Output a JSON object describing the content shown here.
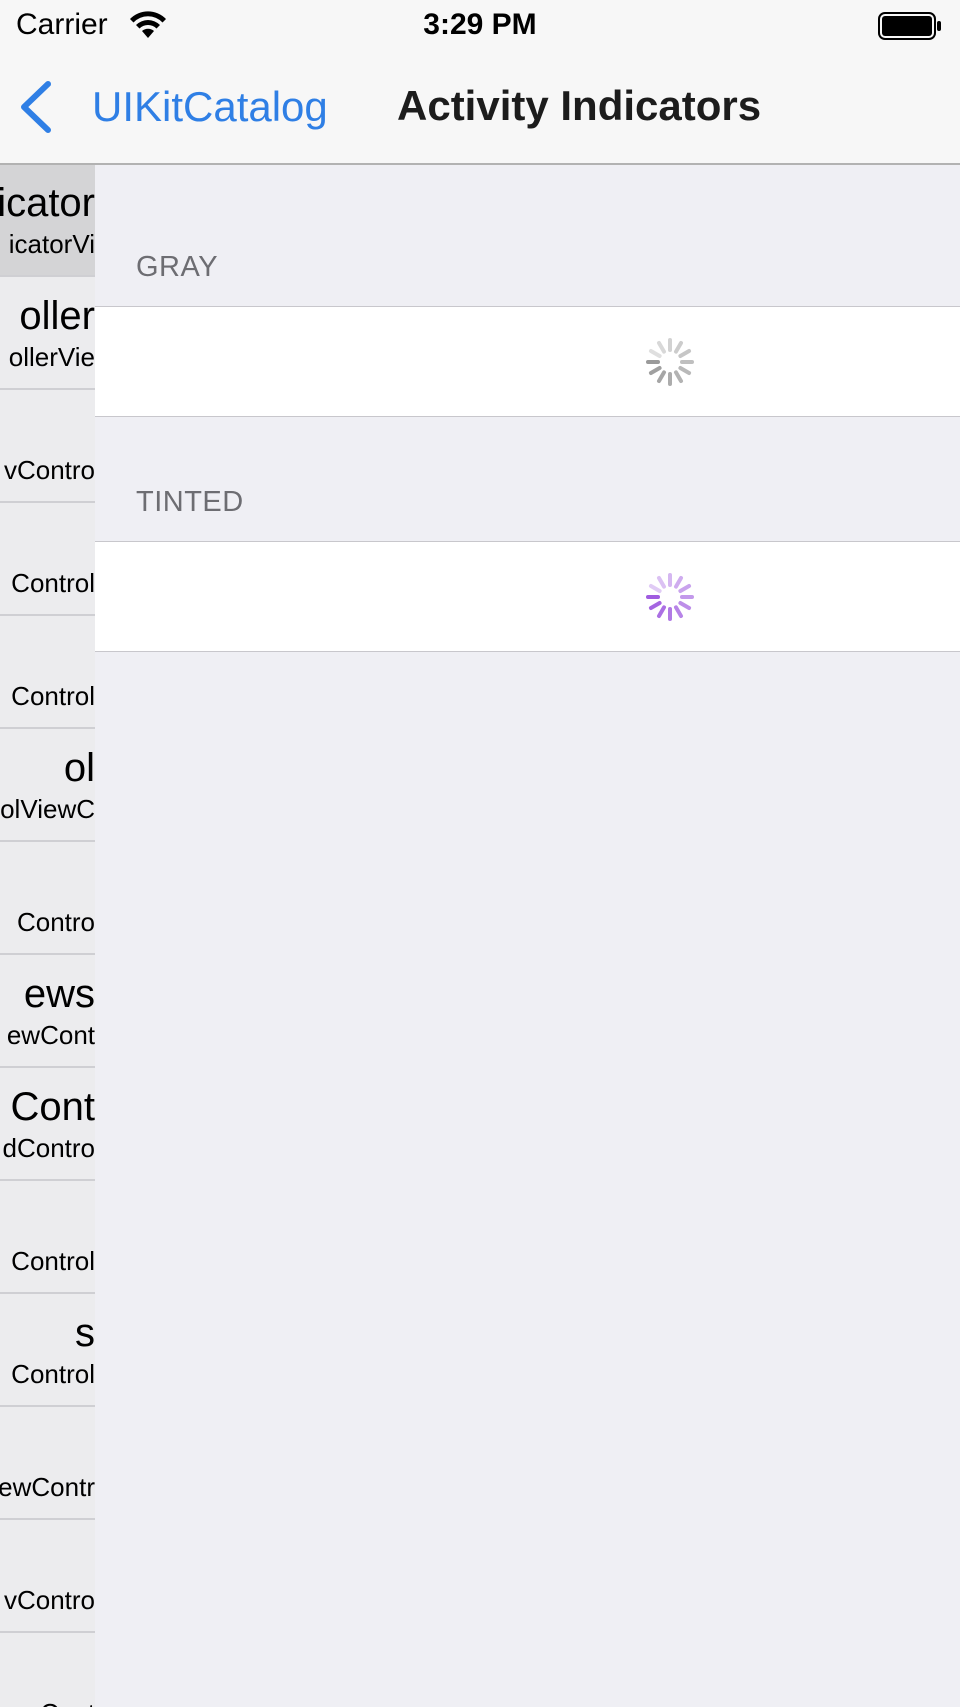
{
  "status_bar": {
    "carrier": "Carrier",
    "time": "3:29 PM"
  },
  "nav": {
    "back_label": "UIKitCatalog",
    "title": "Activity Indicators",
    "accent_color": "#2f7fe5"
  },
  "sidebar": {
    "items": [
      {
        "title": "icator",
        "subtitle": "icatorVi",
        "selected": true
      },
      {
        "title": "oller",
        "subtitle": "ollerVie"
      },
      {
        "title": "",
        "subtitle": "vContro"
      },
      {
        "title": "",
        "subtitle": "Control"
      },
      {
        "title": "",
        "subtitle": "Control"
      },
      {
        "title": "ol",
        "subtitle": "olViewC"
      },
      {
        "title": "",
        "subtitle": "Contro"
      },
      {
        "title": "ews",
        "subtitle": "ewCont"
      },
      {
        "title": " Cont",
        "subtitle": "dContro"
      },
      {
        "title": "",
        "subtitle": "Control"
      },
      {
        "title": "s",
        "subtitle": "Control"
      },
      {
        "title": "",
        "subtitle": "ewContr"
      },
      {
        "title": "",
        "subtitle": "vContro"
      },
      {
        "title": "",
        "subtitle": "ewCont"
      }
    ]
  },
  "sections": [
    {
      "header": "GRAY",
      "spinner_color": "#9a9a9a"
    },
    {
      "header": "TINTED",
      "spinner_color": "#a05ce0"
    }
  ]
}
